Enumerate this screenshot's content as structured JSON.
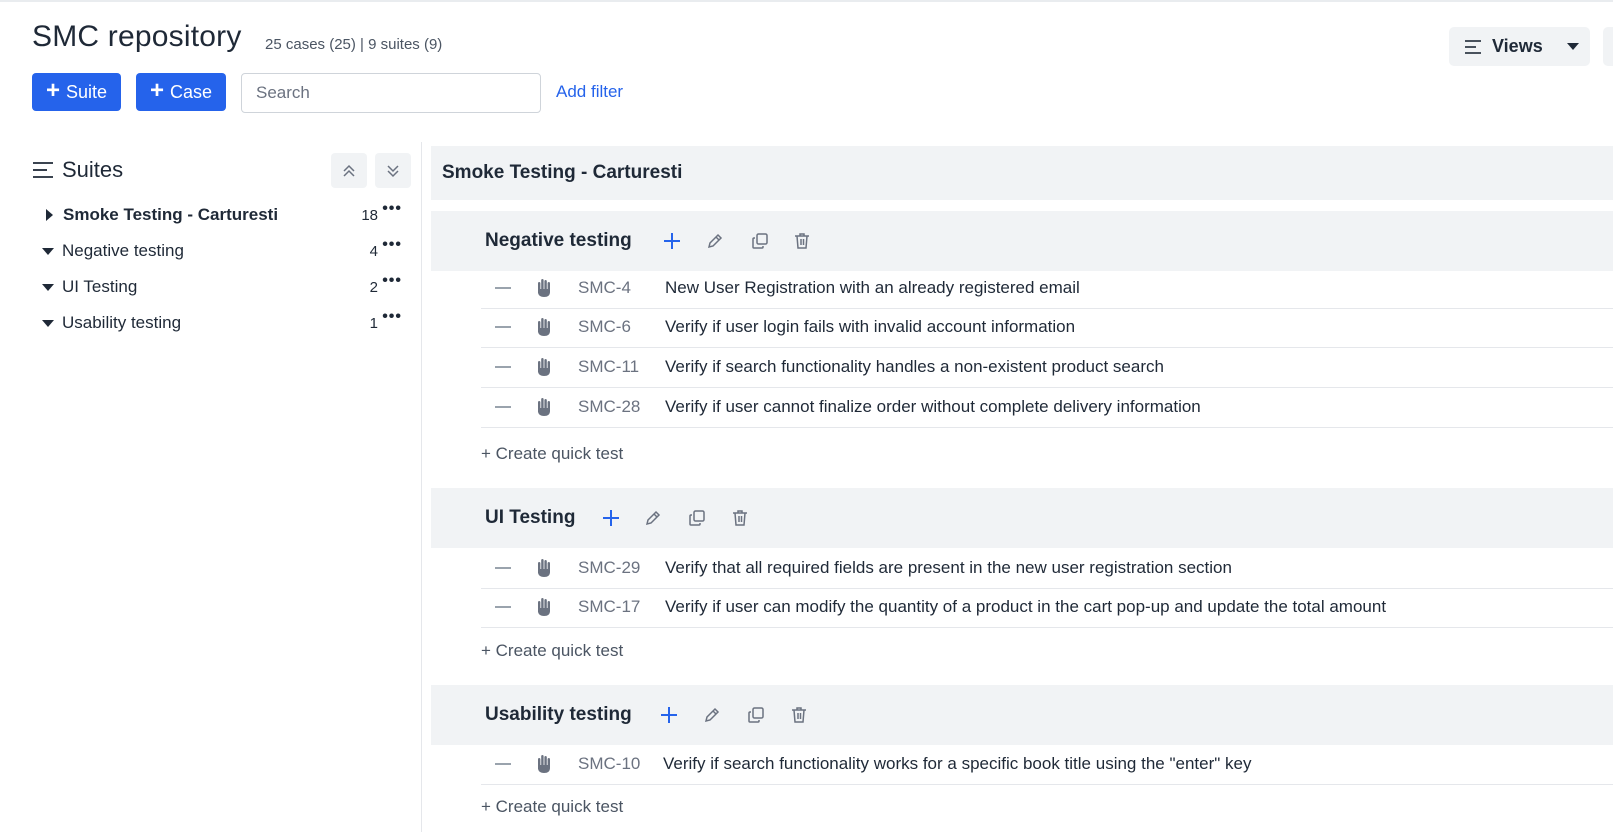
{
  "header": {
    "title": "SMC repository",
    "counts": "25 cases (25) | 9 suites (9)",
    "suite_button": "Suite",
    "case_button": "Case",
    "search_placeholder": "Search",
    "add_filter": "Add filter",
    "views_label": "Views"
  },
  "sidebar": {
    "heading": "Suites",
    "items": [
      {
        "label": "Smoke Testing - Carturesti",
        "count": "18",
        "expanded": false
      },
      {
        "label": "Negative testing",
        "count": "4",
        "expanded": true
      },
      {
        "label": "UI Testing",
        "count": "2",
        "expanded": true
      },
      {
        "label": "Usability testing",
        "count": "1",
        "expanded": true
      }
    ]
  },
  "main": {
    "root_suite": "Smoke Testing - Carturesti",
    "quick_test_label": "+ Create quick test",
    "suites": [
      {
        "name": "Negative testing",
        "cases": [
          {
            "id": "SMC-4",
            "title": "New User Registration with an already registered email"
          },
          {
            "id": "SMC-6",
            "title": "Verify if user login fails with invalid account information"
          },
          {
            "id": "SMC-11",
            "title": "Verify if search functionality handles a non-existent product search"
          },
          {
            "id": "SMC-28",
            "title": "Verify if user cannot finalize order without complete delivery information"
          }
        ]
      },
      {
        "name": "UI Testing",
        "cases": [
          {
            "id": "SMC-29",
            "title": "Verify that all required fields are present in the new user registration section"
          },
          {
            "id": "SMC-17",
            "title": "Verify if user can modify the quantity of a product in the cart pop-up and update the total amount"
          }
        ]
      },
      {
        "name": "Usability testing",
        "cases": [
          {
            "id": "SMC-10",
            "title": "Verify if search functionality works for a specific book title using the \"enter\" key"
          }
        ]
      }
    ]
  },
  "colors": {
    "primary": "#2563eb",
    "text": "#1f2937",
    "muted": "#6b7280",
    "bar_bg": "#f1f3f5"
  }
}
